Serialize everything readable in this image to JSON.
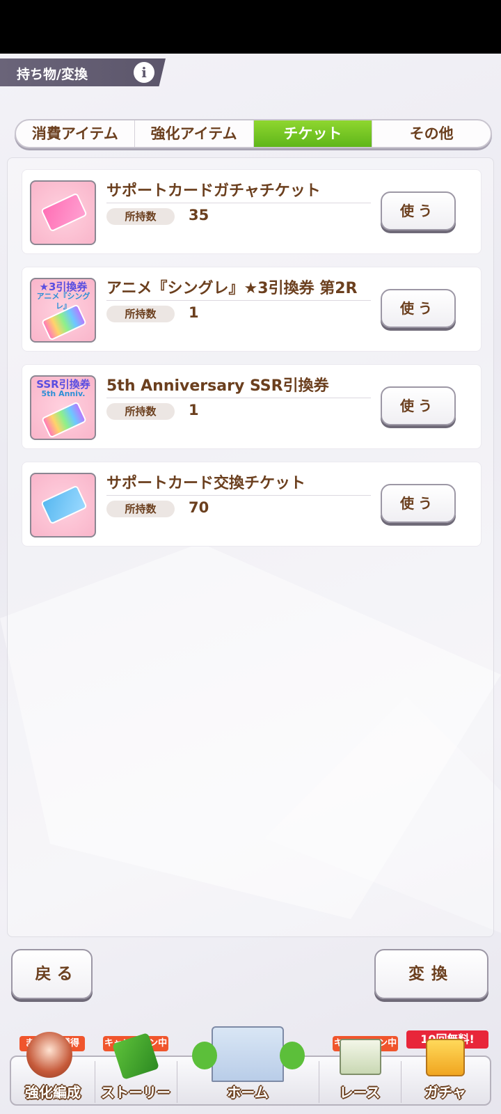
{
  "header": {
    "title": "持ち物/変換",
    "info_label": "i"
  },
  "tabs": [
    {
      "label": "消費アイテム",
      "active": false
    },
    {
      "label": "強化アイテム",
      "active": false
    },
    {
      "label": "チケット",
      "active": true
    },
    {
      "label": "その他",
      "active": false
    }
  ],
  "items": [
    {
      "name": "サポートカードガチャチケット",
      "owned_label": "所持数",
      "owned": "35",
      "use_label": "使う",
      "thumb": "pink-ticket-icon"
    },
    {
      "name": "アニメ『シングレ』★3引換券 第2R",
      "owned_label": "所持数",
      "owned": "1",
      "use_label": "使う",
      "thumb": "star3-exchange-ticket-icon",
      "thumb_text": [
        "★3引換券",
        "アニメ『シングレ』"
      ]
    },
    {
      "name": "5th Anniversary SSR引換券",
      "owned_label": "所持数",
      "owned": "1",
      "use_label": "使う",
      "thumb": "ssr-exchange-ticket-icon",
      "thumb_text": [
        "SSR引換券",
        "5th Anniv."
      ]
    },
    {
      "name": "サポートカード交換チケット",
      "owned_label": "所持数",
      "owned": "70",
      "use_label": "使う",
      "thumb": "blue-ticket-icon"
    }
  ],
  "footer": {
    "back_label": "戻る",
    "exchange_label": "変換"
  },
  "nav": {
    "items": [
      {
        "label": "強化編成",
        "tag": "まとめて獲得"
      },
      {
        "label": "ストーリー",
        "tag": "キャンペーン中"
      },
      {
        "label": "ホーム",
        "tag": ""
      },
      {
        "label": "レース",
        "tag": "キャンペーン中"
      },
      {
        "label": "ガチャ",
        "tag": "10回無料!"
      }
    ]
  },
  "colors": {
    "active_tab": "#6cc21f",
    "text_brown": "#6b3f1e",
    "header_band": "#5c566b",
    "tag_orange": "#f0552c"
  }
}
